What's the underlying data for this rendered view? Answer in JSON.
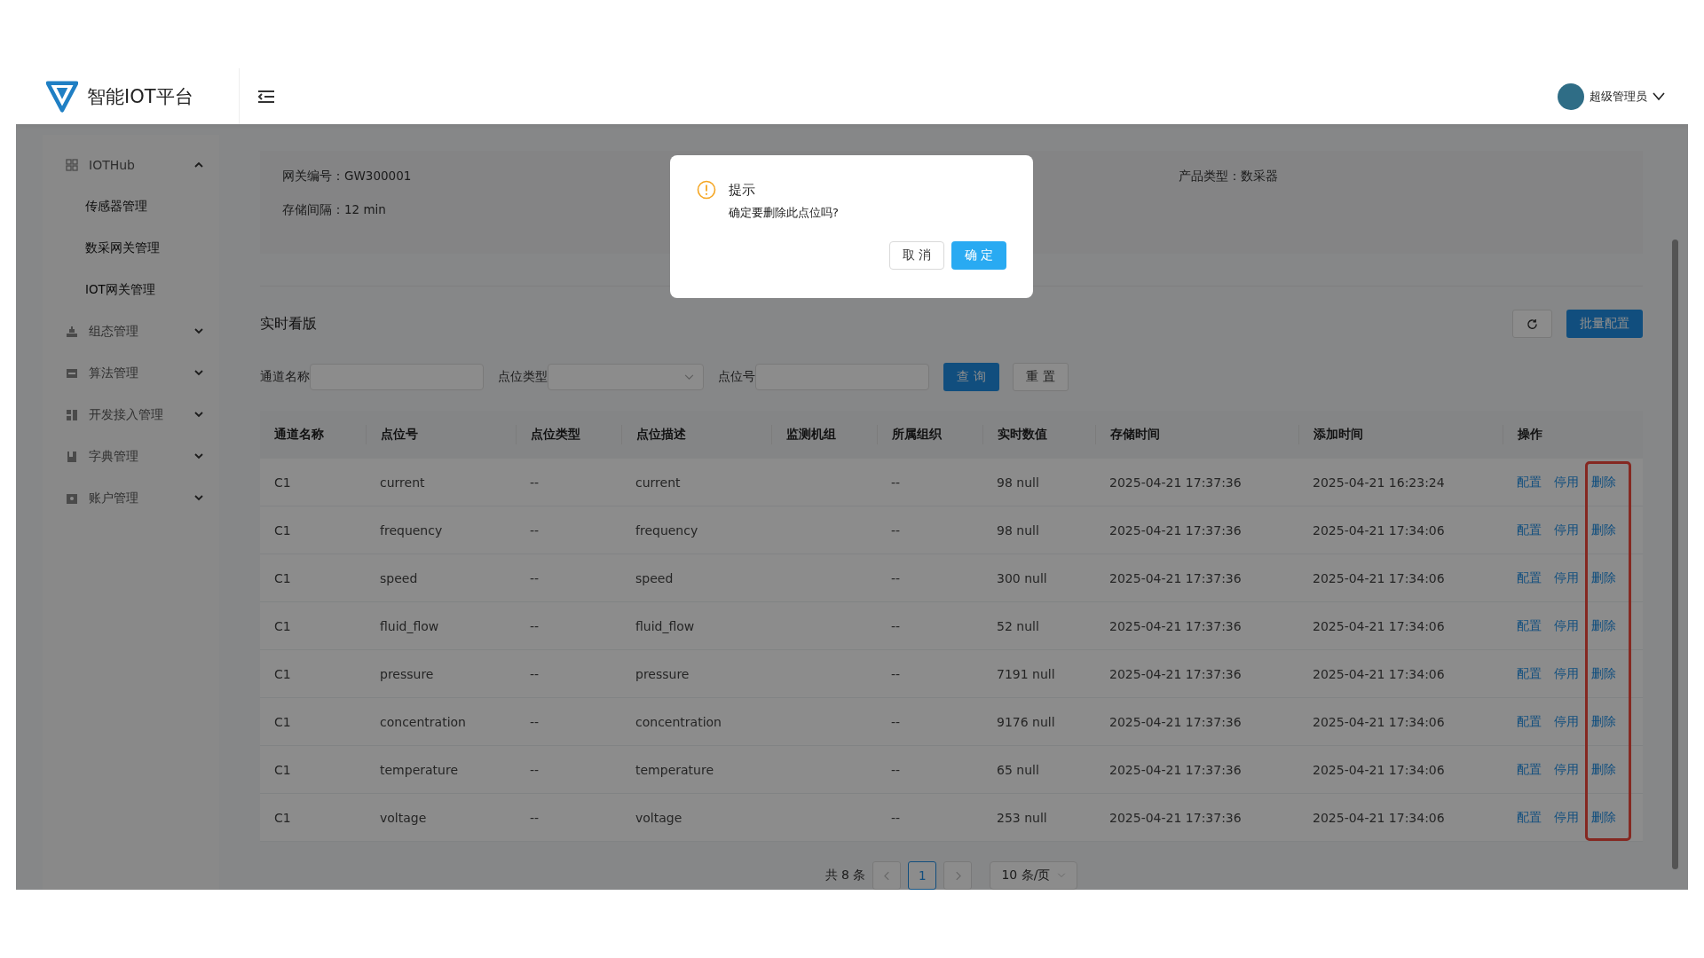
{
  "header": {
    "logo_text": "智能IOT平台",
    "user_name": "超级管理员"
  },
  "sidebar": {
    "items": [
      {
        "label": "IOTHub",
        "expanded": true,
        "children": [
          {
            "label": "传感器管理"
          },
          {
            "label": "数采网关管理"
          },
          {
            "label": "IOT网关管理"
          }
        ]
      },
      {
        "label": "组态管理",
        "expanded": false
      },
      {
        "label": "算法管理",
        "expanded": false
      },
      {
        "label": "开发接入管理",
        "expanded": false
      },
      {
        "label": "字典管理",
        "expanded": false
      },
      {
        "label": "账户管理",
        "expanded": false
      }
    ]
  },
  "basic_info": {
    "fields": [
      {
        "label": "网关编号：",
        "value": "GW300001"
      },
      {
        "label": "存储间隔：",
        "value": "12 min"
      },
      {
        "label": "产品类型：",
        "value": "数采器"
      }
    ]
  },
  "dashboard": {
    "title": "实时看版",
    "batch_button": "批量配置"
  },
  "filters": [
    {
      "label": "通道名称",
      "kind": "text"
    },
    {
      "label": "点位类型",
      "kind": "select"
    },
    {
      "label": "点位号",
      "kind": "text"
    }
  ],
  "filter_buttons": {
    "query": "查 询",
    "reset": "重 置"
  },
  "table": {
    "columns": [
      "通道名称",
      "点位号",
      "点位类型",
      "点位描述",
      "监测机组",
      "所属组织",
      "实时数值",
      "存储时间",
      "添加时间",
      "操作"
    ],
    "rows": [
      {
        "cells": [
          "C1",
          "current",
          "--",
          "current",
          "",
          "--",
          "98 null",
          "2025-04-21 17:37:36",
          "2025-04-21 16:23:24"
        ],
        "actions": [
          "配置",
          "停用",
          "删除"
        ]
      },
      {
        "cells": [
          "C1",
          "frequency",
          "--",
          "frequency",
          "",
          "--",
          "98 null",
          "2025-04-21 17:37:36",
          "2025-04-21 17:34:06"
        ],
        "actions": [
          "配置",
          "停用",
          "删除"
        ]
      },
      {
        "cells": [
          "C1",
          "speed",
          "--",
          "speed",
          "",
          "--",
          "300 null",
          "2025-04-21 17:37:36",
          "2025-04-21 17:34:06"
        ],
        "actions": [
          "配置",
          "停用",
          "删除"
        ]
      },
      {
        "cells": [
          "C1",
          "fluid_flow",
          "--",
          "fluid_flow",
          "",
          "--",
          "52 null",
          "2025-04-21 17:37:36",
          "2025-04-21 17:34:06"
        ],
        "actions": [
          "配置",
          "停用",
          "删除"
        ]
      },
      {
        "cells": [
          "C1",
          "pressure",
          "--",
          "pressure",
          "",
          "--",
          "7191 null",
          "2025-04-21 17:37:36",
          "2025-04-21 17:34:06"
        ],
        "actions": [
          "配置",
          "停用",
          "删除"
        ]
      },
      {
        "cells": [
          "C1",
          "concentration",
          "--",
          "concentration",
          "",
          "--",
          "9176 null",
          "2025-04-21 17:37:36",
          "2025-04-21 17:34:06"
        ],
        "actions": [
          "配置",
          "停用",
          "删除"
        ]
      },
      {
        "cells": [
          "C1",
          "temperature",
          "--",
          "temperature",
          "",
          "--",
          "65 null",
          "2025-04-21 17:37:36",
          "2025-04-21 17:34:06"
        ],
        "actions": [
          "配置",
          "停用",
          "删除"
        ]
      },
      {
        "cells": [
          "C1",
          "voltage",
          "--",
          "voltage",
          "",
          "--",
          "253 null",
          "2025-04-21 17:37:36",
          "2025-04-21 17:34:06"
        ],
        "actions": [
          "配置",
          "停用",
          "删除"
        ]
      }
    ],
    "delete_column_highlighted": true
  },
  "pagination": {
    "total": "共 8 条",
    "pages": [
      {
        "label": "1",
        "selected": true
      }
    ],
    "page_size": "10 条/页"
  },
  "dialog": {
    "title": "提示",
    "message": "确定要删除此点位吗?",
    "cancel": "取 消",
    "confirm": "确 定"
  }
}
